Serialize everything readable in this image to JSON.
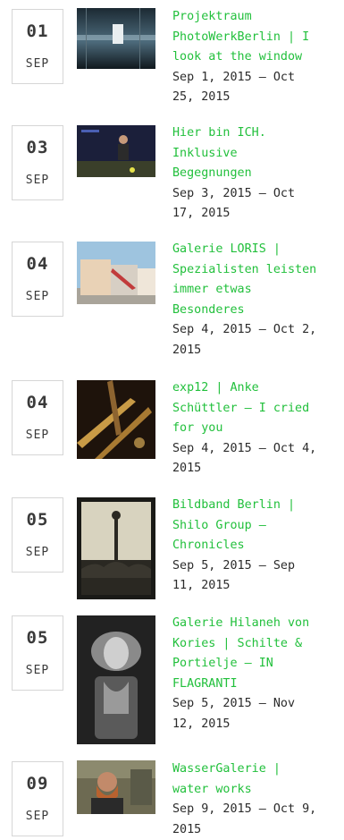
{
  "events": [
    {
      "day": "01",
      "month": "SEP",
      "title_lines": [
        "Projektraum",
        "PhotoWerkBerlin | I",
        "look at the window"
      ],
      "date_lines": [
        "Sep 1, 2015 — Oct",
        "25, 2015"
      ]
    },
    {
      "day": "03",
      "month": "SEP",
      "title_lines": [
        "Hier bin ICH.",
        "Inklusive",
        "Begegnungen"
      ],
      "date_lines": [
        "Sep 3, 2015 — Oct",
        "17, 2015"
      ]
    },
    {
      "day": "04",
      "month": "SEP",
      "title_lines": [
        "Galerie LORIS |",
        "Spezialisten leisten",
        "immer etwas",
        "Besonderes"
      ],
      "date_lines": [
        "Sep 4, 2015 — Oct 2,",
        "2015"
      ]
    },
    {
      "day": "04",
      "month": "SEP",
      "title_lines": [
        "exp12 | Anke",
        "Schüttler — I cried",
        "for you"
      ],
      "date_lines": [
        "Sep 4, 2015 — Oct 4,",
        "2015"
      ]
    },
    {
      "day": "05",
      "month": "SEP",
      "title_lines": [
        "Bildband Berlin |",
        "Shilo Group —",
        "Chronicles"
      ],
      "date_lines": [
        "Sep 5, 2015 — Sep",
        "11, 2015"
      ]
    },
    {
      "day": "05",
      "month": "SEP",
      "title_lines": [
        "Galerie Hilaneh von",
        "Kories | Schilte &",
        "Portielje — IN",
        "FLAGRANTI"
      ],
      "date_lines": [
        "Sep 5, 2015 — Nov",
        "12, 2015"
      ]
    },
    {
      "day": "09",
      "month": "SEP",
      "title_lines": [
        "WasserGalerie |",
        "water works"
      ],
      "date_lines": [
        "Sep 9, 2015 — Oct 9,",
        "2015"
      ]
    }
  ],
  "colors": {
    "title": "#22c03c",
    "text": "#2b2b2b",
    "border": "#d6d6d6"
  }
}
